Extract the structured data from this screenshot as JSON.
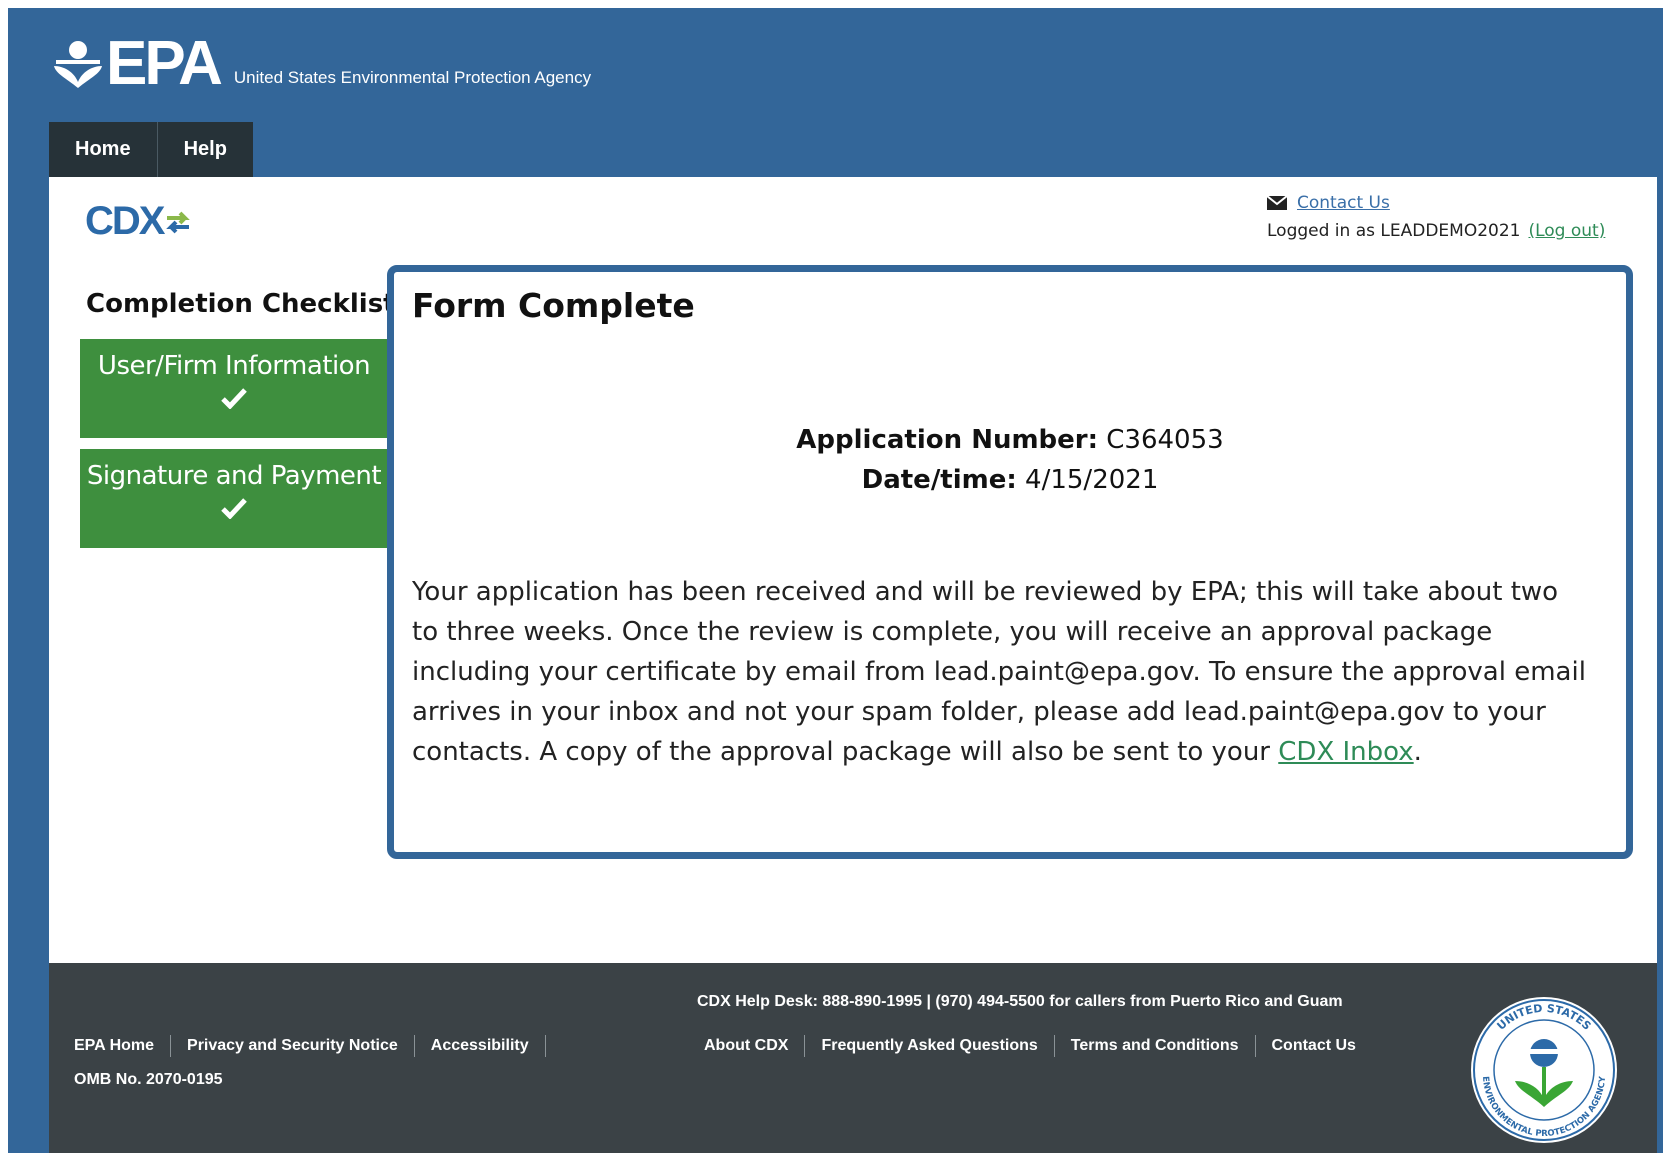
{
  "header": {
    "logo_text": "EPA",
    "agency_name": "United States Environmental Protection Agency",
    "nav": [
      "Home",
      "Help"
    ]
  },
  "cdx_logo": "CDX",
  "user": {
    "contact_label": "Contact Us",
    "logged_in_prefix": "Logged in as LEADDEMO2021",
    "logout_label": "(Log out)"
  },
  "checklist": {
    "title": "Completion Checklist",
    "items": [
      {
        "label": "User/Firm Information",
        "status": "complete"
      },
      {
        "label": "Signature and Payment",
        "status": "complete"
      }
    ]
  },
  "panel": {
    "title": "Form Complete",
    "app_number_label": "Application Number:",
    "app_number": "C364053",
    "datetime_label": "Date/time:",
    "datetime": "4/15/2021",
    "message": "Your application has been received and will be reviewed by EPA; this will take about two to three weeks. Once the review is complete, you will receive an approval package including your certificate by email from lead.paint@epa.gov. To ensure the approval email arrives in your inbox and not your spam folder, please add lead.paint@epa.gov to your contacts. A copy of the approval package will also be sent to your",
    "inbox_link": "CDX Inbox",
    "message_end": "."
  },
  "footer": {
    "left_links": [
      "EPA Home",
      "Privacy and Security Notice",
      "Accessibility"
    ],
    "omb": "OMB No. 2070-0195",
    "helpdesk": "CDX Help Desk: 888-890-1995 | (970) 494-5500 for callers from Puerto Rico and Guam",
    "mid_links": [
      "About CDX",
      "Frequently Asked Questions",
      "Terms and Conditions",
      "Contact Us"
    ],
    "seal_text_top": "UNITED STATES",
    "seal_text_bottom": "ENVIRONMENTAL PROTECTION AGENCY"
  },
  "colors": {
    "brand_blue": "#336699",
    "checklist_green": "#3e8f3e",
    "footer_bg": "#3b4246",
    "link_green": "#2e8b57"
  }
}
